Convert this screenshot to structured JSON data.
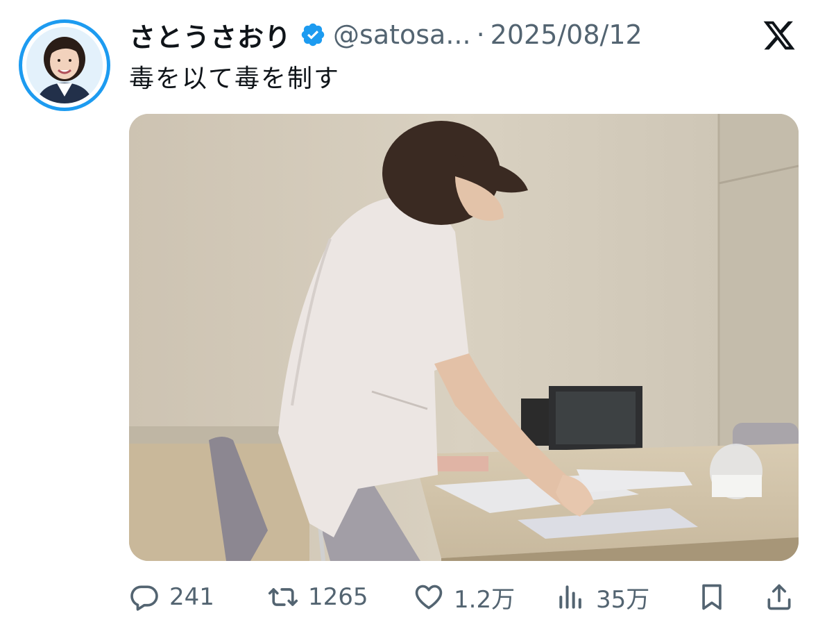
{
  "author": {
    "display_name": "さとうさおり",
    "handle": "@satosa...",
    "separator": "·",
    "date": "2025/08/12",
    "verified": true
  },
  "tweet": {
    "text": "毒を以て毒を制す"
  },
  "metrics": {
    "replies": "241",
    "reposts": "1265",
    "likes": "1.2万",
    "views": "35万"
  },
  "colors": {
    "accent": "#1d9bf0",
    "secondary_text": "#536471",
    "primary_text": "#0f1419"
  },
  "icons": [
    "verified-badge-icon",
    "x-logo-icon",
    "reply-icon",
    "repost-icon",
    "like-icon",
    "views-icon",
    "bookmark-icon",
    "share-icon"
  ]
}
